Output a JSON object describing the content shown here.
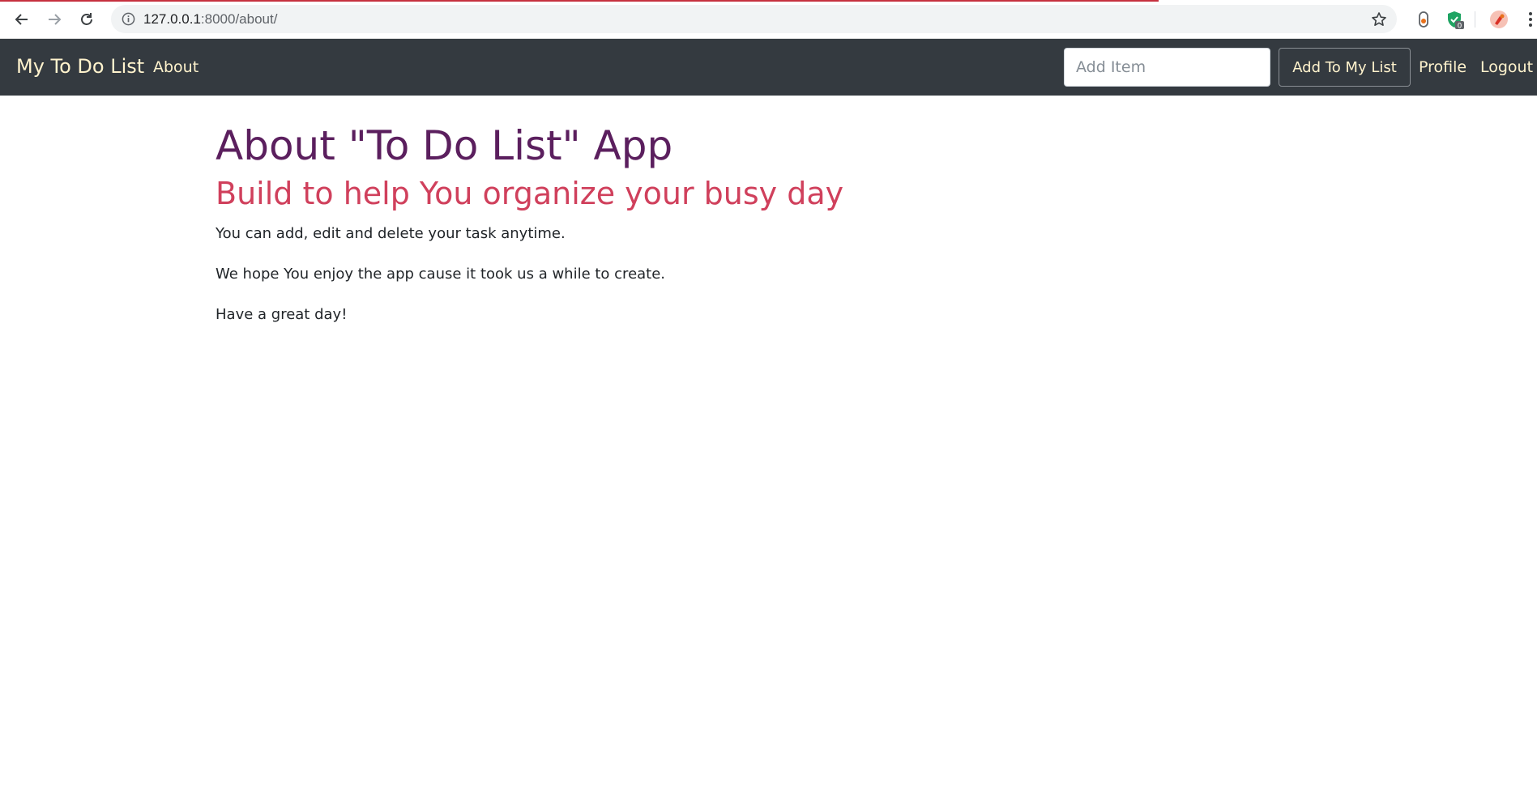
{
  "browser": {
    "url_host": "127.0.0.1",
    "url_rest": ":8000/about/",
    "extension_badge": "0"
  },
  "navbar": {
    "brand": "My To Do List",
    "about_link": "About",
    "add_item_placeholder": "Add Item",
    "add_button": "Add To My List",
    "profile_link": "Profile",
    "logout_link": "Logout"
  },
  "main": {
    "title": "About \"To Do List\" App",
    "subtitle": "Build to help You organize your busy day",
    "paragraphs": [
      "You can add, edit and delete your task anytime.",
      "We hope You enjoy the app cause it took us a while to create.",
      "Have a great day!"
    ]
  },
  "colors": {
    "navbar_bg": "#343a40",
    "nav_text": "#fff3cd",
    "title": "#5b1f5e",
    "subtitle": "#d0405c",
    "body_text": "#212529",
    "load_bar": "#c6303e"
  }
}
